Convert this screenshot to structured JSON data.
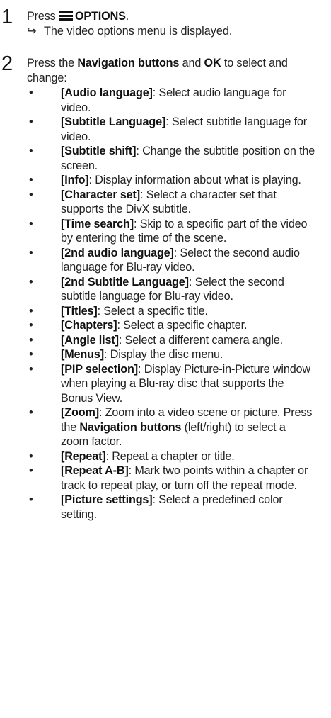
{
  "steps": [
    {
      "number": "1",
      "prefix": "Press ",
      "bold": "OPTIONS",
      "suffix": ".",
      "result_marker": "↪",
      "result": "The video options menu is displayed."
    },
    {
      "number": "2",
      "parts": [
        "Press the ",
        "Navigation buttons",
        " and ",
        "OK",
        " to select and change:"
      ]
    }
  ],
  "bullet_marker": "•",
  "options": [
    {
      "label": "[Audio language]",
      "desc": ": Select audio language for video."
    },
    {
      "label": "[Subtitle Language]",
      "desc": ": Select subtitle language for video."
    },
    {
      "label": "[Subtitle shift]",
      "desc": ": Change the subtitle position on the screen."
    },
    {
      "label": "[Info]",
      "desc": ": Display information about what is playing."
    },
    {
      "label": "[Character set]",
      "desc": ": Select a character set that supports the DivX subtitle."
    },
    {
      "label": "[Time search]",
      "desc": ": Skip to a specific part of the video by entering the time of the scene."
    },
    {
      "label": "[2nd audio language]",
      "desc": ": Select the second audio language for Blu-ray video."
    },
    {
      "label": "[2nd Subtitle Language]",
      "desc": ": Select the second subtitle language for Blu-ray video."
    },
    {
      "label": "[Titles]",
      "desc": ": Select a specific title."
    },
    {
      "label": "[Chapters]",
      "desc": ": Select a specific chapter."
    },
    {
      "label": "[Angle list]",
      "desc": ": Select a different camera angle."
    },
    {
      "label": "[Menus]",
      "desc": ": Display the disc menu."
    },
    {
      "label": "[PIP selection]",
      "desc": ": Display Picture-in-Picture window when playing a Blu-ray disc that supports the Bonus View."
    },
    {
      "label": "[Zoom]",
      "desc": ": Zoom into a video scene or picture. Press the ",
      "bold2": "Navigation buttons",
      "desc2": " (left/right) to select a zoom factor."
    },
    {
      "label": "[Repeat]",
      "desc": ": Repeat a chapter or title."
    },
    {
      "label": "[Repeat A-B]",
      "desc": ": Mark two points within a chapter or track to repeat play, or turn off the repeat mode."
    },
    {
      "label": "[Picture settings]",
      "desc": ": Select a predefined color setting."
    }
  ]
}
